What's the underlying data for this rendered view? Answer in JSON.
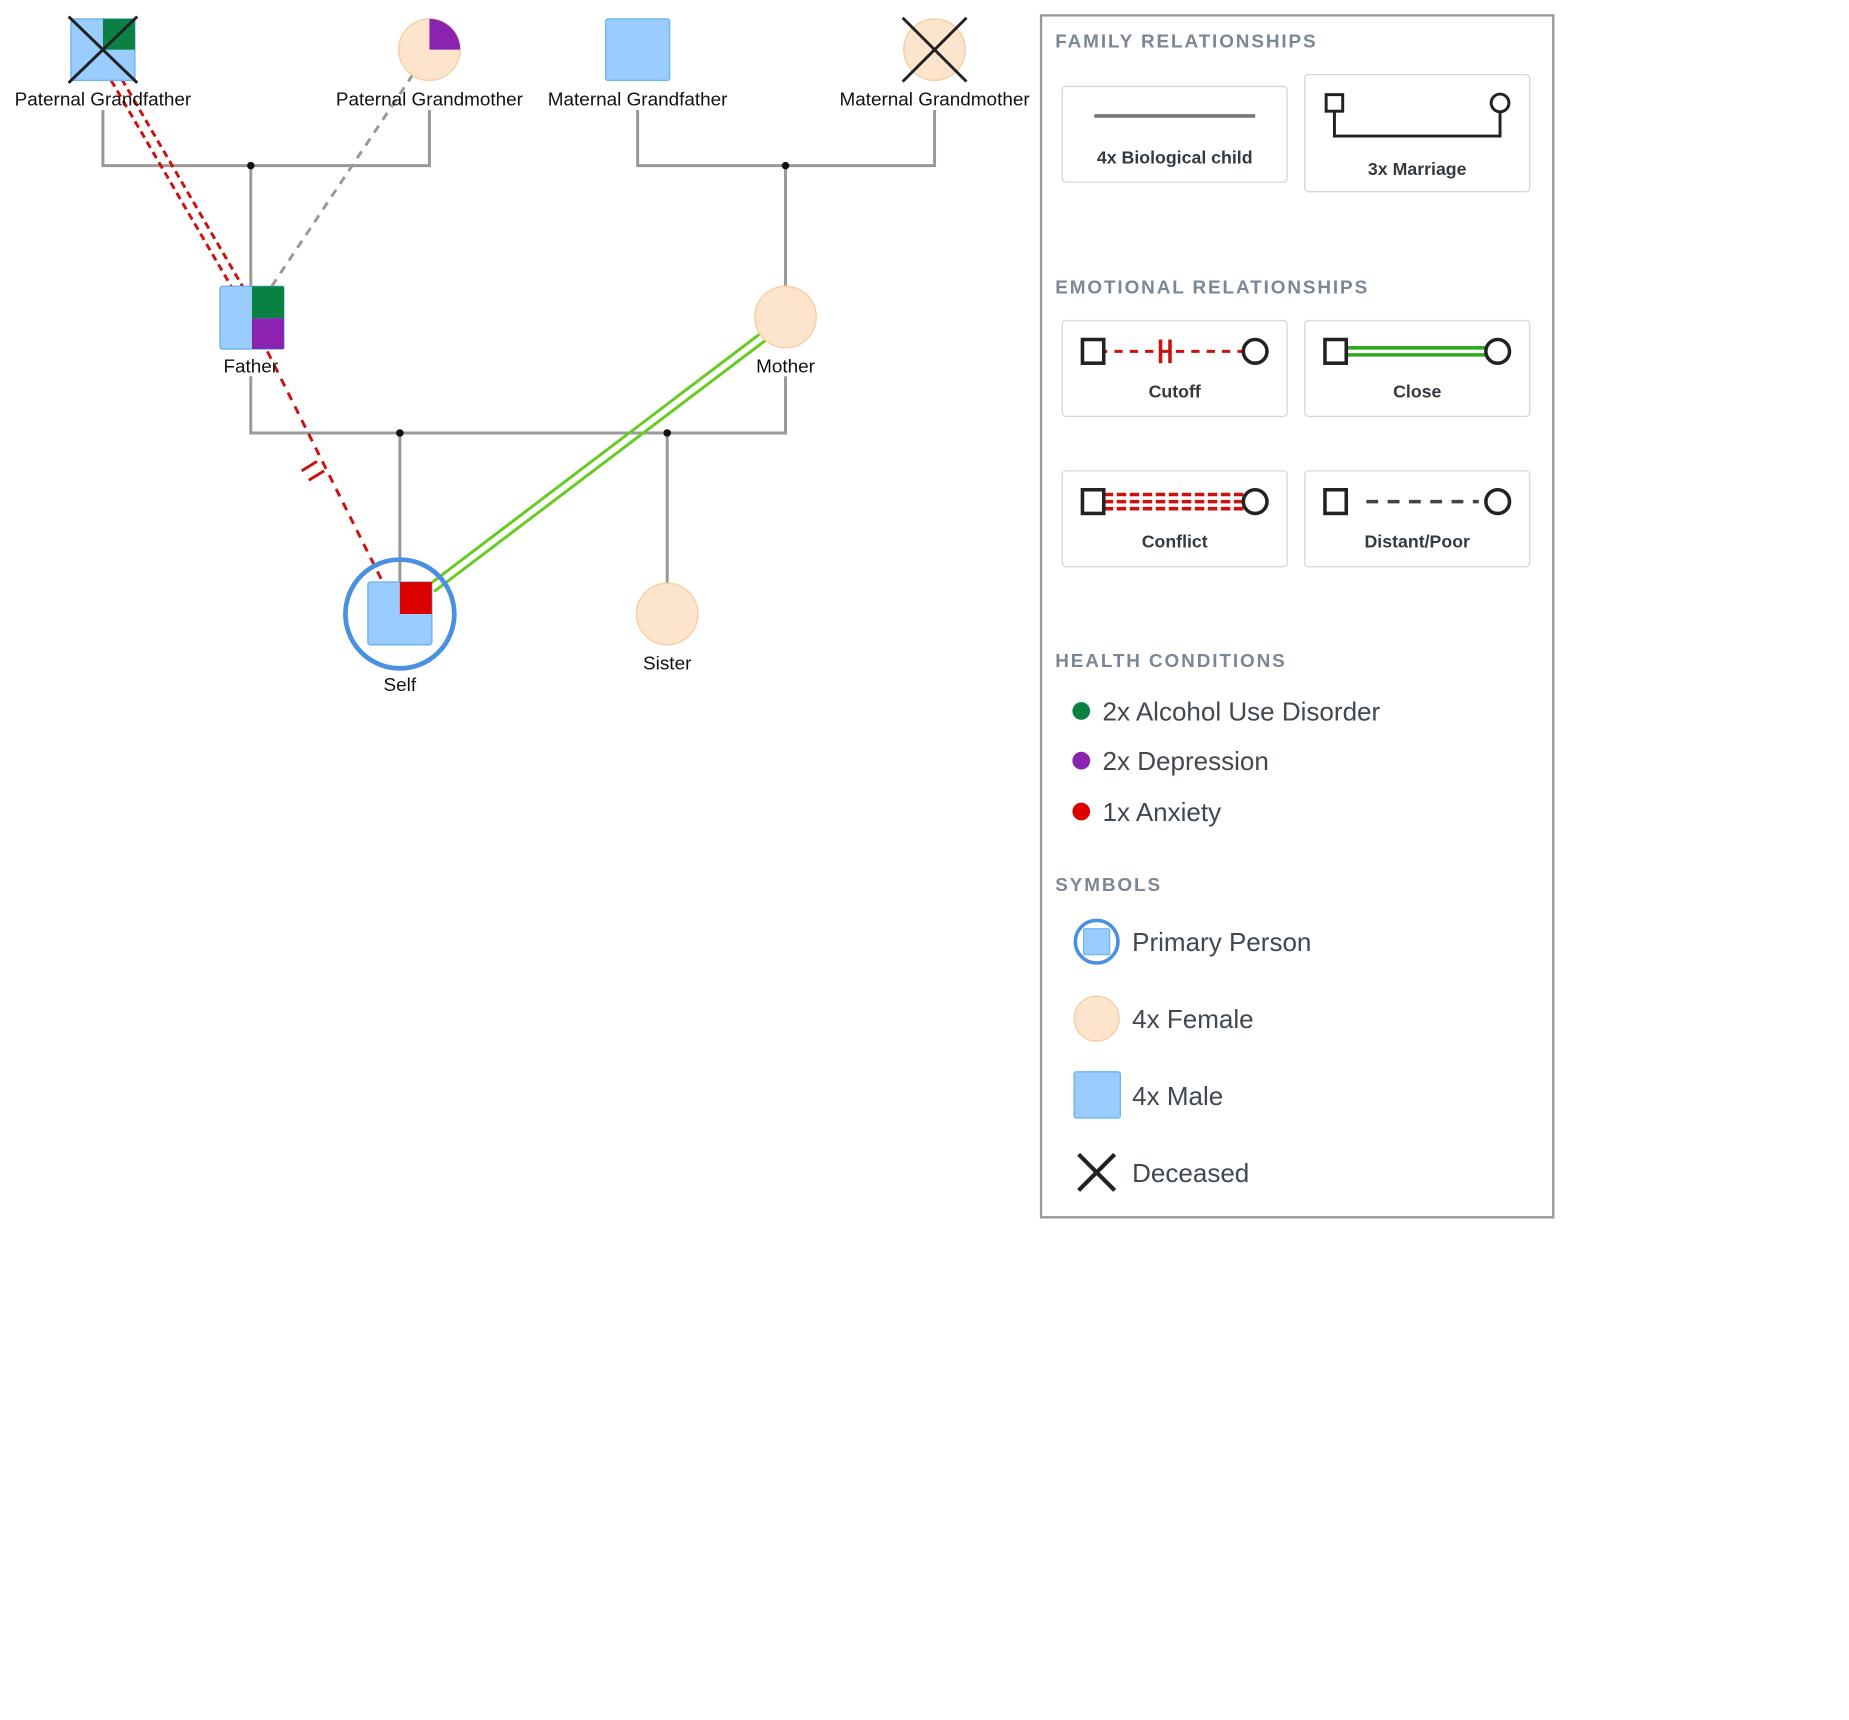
{
  "people": {
    "paternal_grandfather": {
      "label": "Paternal Grandfather"
    },
    "paternal_grandmother": {
      "label": "Paternal Grandmother"
    },
    "maternal_grandfather": {
      "label": "Maternal Grandfather"
    },
    "maternal_grandmother": {
      "label": "Maternal Grandmother"
    },
    "father": {
      "label": "Father"
    },
    "mother": {
      "label": "Mother"
    },
    "self": {
      "label": "Self"
    },
    "sister": {
      "label": "Sister"
    }
  },
  "legend": {
    "family": {
      "heading": "FAMILY RELATIONSHIPS",
      "biological_child": "4x Biological child",
      "marriage": "3x Marriage"
    },
    "emotional": {
      "heading": "EMOTIONAL RELATIONSHIPS",
      "cutoff": "Cutoff",
      "close": "Close",
      "conflict": "Conflict",
      "distant": "Distant/Poor"
    },
    "health": {
      "heading": "HEALTH CONDITIONS",
      "alcohol": "2x Alcohol Use Disorder",
      "depression": "2x Depression",
      "anxiety": "1x Anxiety"
    },
    "symbols": {
      "heading": "SYMBOLS",
      "primary": "Primary Person",
      "female": "4x Female",
      "male": "4x Male",
      "deceased": "Deceased"
    }
  },
  "colors": {
    "male_fill": "#99ccff",
    "male_stroke": "#6fb3f0",
    "female_fill": "#fde5cd",
    "female_stroke": "#f5cfa6",
    "alcohol": "#0a8042",
    "depression": "#8b23b0",
    "anxiety": "#dd0000",
    "primary_ring": "#4a90e2",
    "family_line": "#999999",
    "conflict": "#cc1111",
    "close": "#66cc22",
    "distant": "#999999",
    "panel_border": "#999999"
  }
}
